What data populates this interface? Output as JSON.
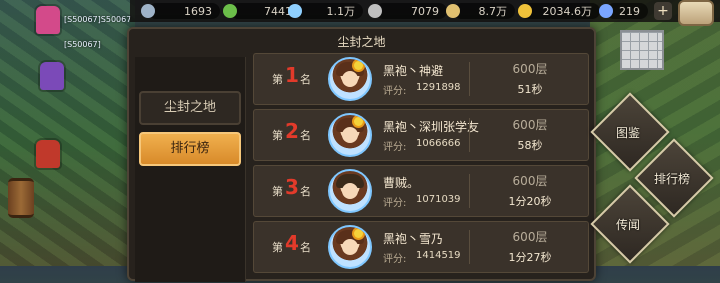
{
  "resources": [
    {
      "value": "1693",
      "icon": "stone-icon",
      "color": "#9fb3c8"
    },
    {
      "value": "7441",
      "icon": "leaf-icon",
      "color": "#6cbf4a"
    },
    {
      "value": "1.1万",
      "icon": "crystal-icon",
      "color": "#8fd0ff"
    },
    {
      "value": "7079",
      "icon": "ore-icon",
      "color": "#c0c0c0"
    },
    {
      "value": "8.7万",
      "icon": "grain-icon",
      "color": "#e0c070"
    },
    {
      "value": "2034.6万",
      "icon": "gold-coin-icon",
      "color": "#f0c23a"
    },
    {
      "value": "219",
      "icon": "diamond-icon",
      "color": "#7aa6ff"
    }
  ],
  "background_players": [
    {
      "tag": "[S50067]S50067"
    },
    {
      "tag": "[S50067]"
    }
  ],
  "modal": {
    "title": "尘封之地",
    "tabs": [
      {
        "label": "尘封之地"
      },
      {
        "label": "排行榜"
      }
    ],
    "rank_prefix": "第",
    "rank_suffix": "名",
    "score_label": "评分:",
    "rows": [
      {
        "rank": "1",
        "name": "黑袍丶神避",
        "score": "1291898",
        "floor": "600层",
        "time": "51秒"
      },
      {
        "rank": "2",
        "name": "黑袍丶深圳张学友",
        "score": "1066666",
        "floor": "600层",
        "time": "58秒"
      },
      {
        "rank": "3",
        "name": "曹贼。",
        "score": "1071039",
        "floor": "600层",
        "time": "1分20秒"
      },
      {
        "rank": "4",
        "name": "黑袍丶雪乃",
        "score": "1414519",
        "floor": "600层",
        "time": "1分27秒"
      }
    ]
  },
  "side_buttons": [
    {
      "label": "图鉴"
    },
    {
      "label": "排行榜"
    },
    {
      "label": "传闻"
    }
  ],
  "colors": {
    "rank_number": "#e23a2a",
    "active_tab": "#e69b38",
    "panel_bg": "#27221d"
  }
}
